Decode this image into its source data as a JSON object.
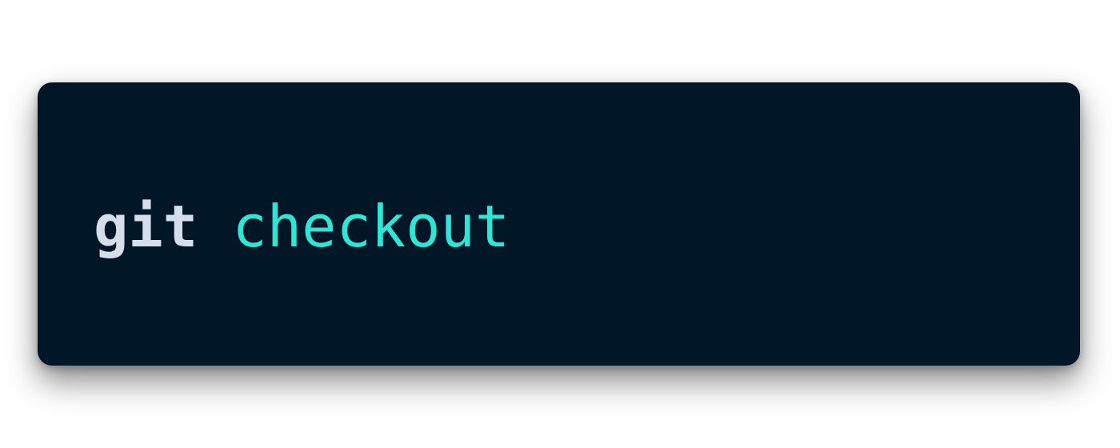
{
  "code": {
    "command": "git",
    "argument": "checkout"
  },
  "colors": {
    "page_background": "#ffffff",
    "card_background": "#011627",
    "command_text": "#d6deeb",
    "argument_text": "#2ee6d6"
  }
}
